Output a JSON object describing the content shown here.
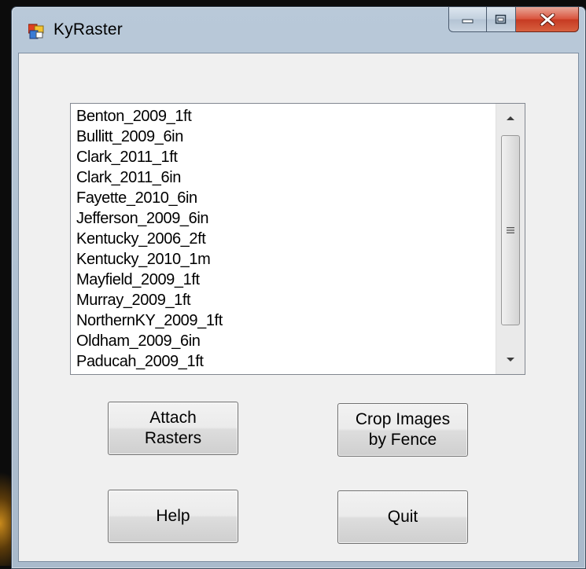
{
  "window": {
    "title": "KyRaster",
    "icon": "app-window-icon",
    "caption_buttons": [
      "minimize-icon",
      "maximize-icon",
      "close-icon"
    ]
  },
  "listbox": {
    "items": [
      "Benton_2009_1ft",
      "Bullitt_2009_6in",
      "Clark_2011_1ft",
      "Clark_2011_6in",
      "Fayette_2010_6in",
      "Jefferson_2009_6in",
      "Kentucky_2006_2ft",
      "Kentucky_2010_1m",
      "Mayfield_2009_1ft",
      "Murray_2009_1ft",
      "NorthernKY_2009_1ft",
      "Oldham_2009_6in",
      "Paducah_2009_1ft"
    ],
    "scrollbar": {
      "up_icon": "scroll-up-arrow-icon",
      "down_icon": "scroll-down-arrow-icon",
      "thumb_grip_icon": "grip-lines-icon"
    }
  },
  "buttons": {
    "attach": "Attach\nRasters",
    "crop": "Crop Images\nby Fence",
    "help": "Help",
    "quit": "Quit"
  },
  "colors": {
    "close_button": "#c63a22",
    "window_frame": "#aebfd0",
    "client_background": "#f0f0f0"
  }
}
